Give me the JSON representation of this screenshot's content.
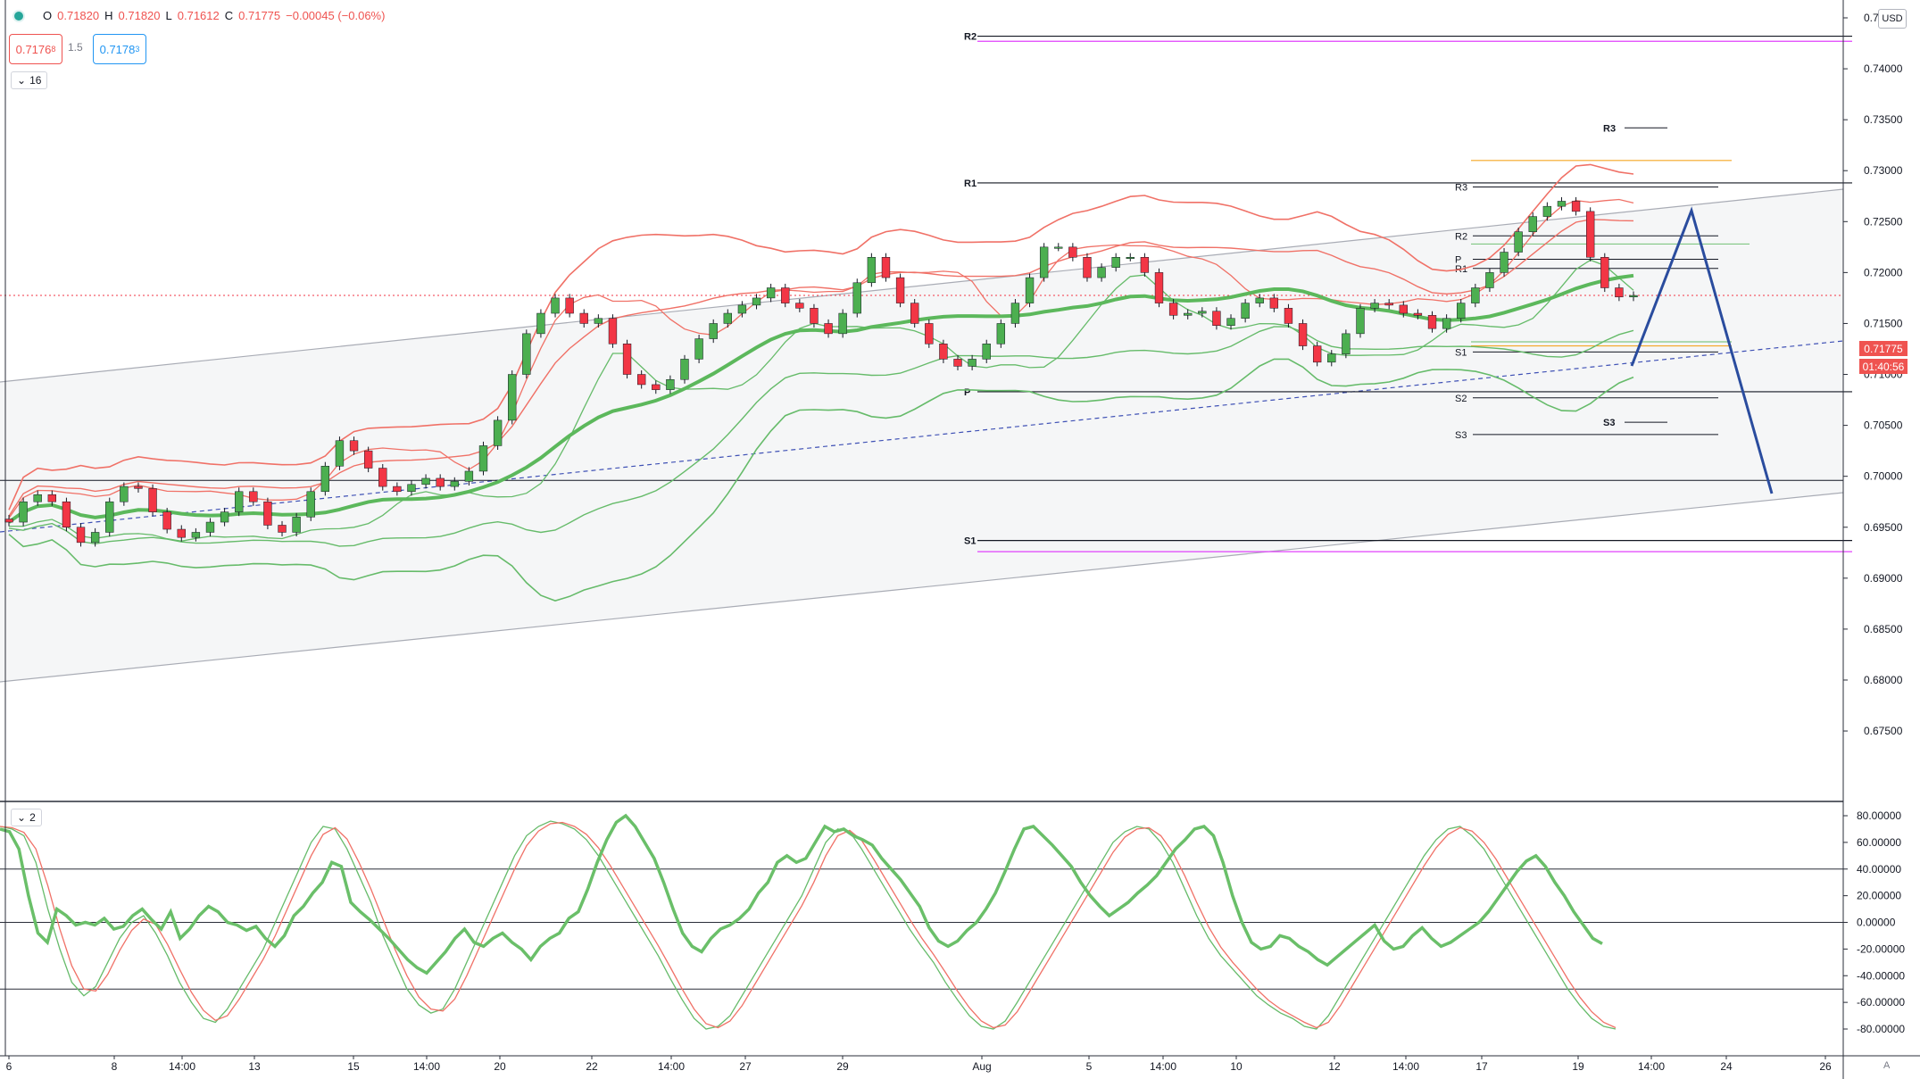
{
  "header": {
    "open_label": "O",
    "open": "0.71820",
    "high_label": "H",
    "high": "0.71820",
    "low_label": "L",
    "low": "0.71612",
    "close_label": "C",
    "close": "0.71775",
    "change": "−0.00045 (−0.06%)"
  },
  "trade": {
    "sell": "0.7176",
    "sell_sup": "8",
    "spread": "1.5",
    "buy": "0.7178",
    "buy_sup": "3"
  },
  "panes": {
    "main_count": "16",
    "osc_count": "2"
  },
  "currency": "USD",
  "last_price": "0.71775",
  "countdown": "01:40:56",
  "auto_label": "A",
  "colors": {
    "up": "#4caf50",
    "down": "#f23645",
    "bb_red": "#f07167",
    "bb_green": "#66bb6a",
    "trend": "#2a4c9e",
    "channel": "#a9acb5",
    "orange": "#f5a623",
    "magenta": "#e040fb"
  },
  "chart_data": [
    {
      "type": "candlestick",
      "title": "",
      "yaxis": {
        "ticks": [
          "0.74500",
          "0.74000",
          "0.73500",
          "0.73000",
          "0.72500",
          "0.72000",
          "0.71500",
          "0.71000",
          "0.70500",
          "0.70000",
          "0.69500",
          "0.69000",
          "0.68500",
          "0.68000",
          "0.67500"
        ],
        "range": [
          0.6715,
          0.7525
        ]
      },
      "xaxis": {
        "labels": [
          "6",
          "8",
          "14:00",
          "13",
          "15",
          "14:00",
          "20",
          "22",
          "14:00",
          "27",
          "29",
          "Aug",
          "5",
          "14:00",
          "10",
          "12",
          "14:00",
          "17",
          "19",
          "14:00",
          "24",
          "26"
        ]
      },
      "pivots_weekly": [
        {
          "label": "R2",
          "value": 0.7432
        },
        {
          "label": "R1",
          "value": 0.7288
        },
        {
          "label": "P",
          "value": 0.7083
        },
        {
          "label": "S1",
          "value": 0.6937
        }
      ],
      "pivots_daily": [
        {
          "label": "R3",
          "value": 0.7284
        },
        {
          "label": "R2",
          "value": 0.7236
        },
        {
          "label": "R1",
          "value": 0.7204
        },
        {
          "label": "P",
          "value": 0.7213
        },
        {
          "label": "S1",
          "value": 0.7122
        },
        {
          "label": "S2",
          "value": 0.7077
        },
        {
          "label": "S3",
          "value": 0.7041
        }
      ],
      "pivots_intraday": [
        {
          "label": "R3",
          "value": 0.7342
        },
        {
          "label": "S3",
          "value": 0.7053
        }
      ],
      "horizontal_line": 0.6996,
      "last_price": 0.71775,
      "close_series": [
        0.6955,
        0.6975,
        0.6982,
        0.6975,
        0.695,
        0.6935,
        0.6945,
        0.6975,
        0.699,
        0.6988,
        0.6965,
        0.6948,
        0.694,
        0.6945,
        0.6955,
        0.6965,
        0.6985,
        0.6975,
        0.6952,
        0.6945,
        0.696,
        0.6985,
        0.701,
        0.7035,
        0.7025,
        0.7008,
        0.699,
        0.6985,
        0.6992,
        0.6998,
        0.699,
        0.6995,
        0.7005,
        0.703,
        0.7055,
        0.71,
        0.714,
        0.716,
        0.7175,
        0.716,
        0.715,
        0.7155,
        0.713,
        0.71,
        0.709,
        0.7085,
        0.7095,
        0.7115,
        0.7135,
        0.715,
        0.716,
        0.7168,
        0.7175,
        0.7185,
        0.717,
        0.7165,
        0.715,
        0.714,
        0.716,
        0.719,
        0.7215,
        0.7195,
        0.717,
        0.715,
        0.713,
        0.7115,
        0.7108,
        0.7115,
        0.713,
        0.715,
        0.717,
        0.7195,
        0.7225,
        0.7225,
        0.7215,
        0.7195,
        0.7205,
        0.7215,
        0.7215,
        0.72,
        0.717,
        0.7158,
        0.716,
        0.7162,
        0.7148,
        0.7155,
        0.717,
        0.7175,
        0.7165,
        0.715,
        0.7128,
        0.7112,
        0.712,
        0.714,
        0.7165,
        0.717,
        0.7168,
        0.716,
        0.7158,
        0.7145,
        0.7155,
        0.717,
        0.7185,
        0.72,
        0.722,
        0.724,
        0.7255,
        0.7265,
        0.727,
        0.726,
        0.7215,
        0.7185,
        0.7176,
        0.71775
      ]
    },
    {
      "type": "line",
      "title": "",
      "yaxis": {
        "ticks": [
          "80.00000",
          "60.00000",
          "40.00000",
          "20.00000",
          "0.00000",
          "-20.00000",
          "-40.00000",
          "-60.00000",
          "-80.00000"
        ],
        "range": [
          -86,
          86
        ]
      },
      "levels": [
        40,
        0,
        -50
      ],
      "series": [
        {
          "values": [
            70,
            68,
            55,
            20,
            -8,
            -15,
            10,
            5,
            -2,
            0,
            -2,
            3,
            -5,
            -3,
            5,
            10,
            2,
            -5,
            8,
            -12,
            -5,
            5,
            12,
            8,
            0,
            -2,
            -6,
            -3,
            -12,
            -18,
            -10,
            5,
            12,
            22,
            30,
            45,
            42,
            15,
            8,
            2,
            -5,
            -12,
            -20,
            -28,
            -34,
            -38,
            -30,
            -22,
            -12,
            -5,
            -15,
            -18,
            -12,
            -8,
            -15,
            -20,
            -28,
            -18,
            -12,
            -8,
            3,
            8,
            25,
            45,
            62,
            75,
            80,
            72,
            60,
            48,
            30,
            10,
            -8,
            -18,
            -22,
            -12,
            -5,
            -2,
            3,
            10,
            22,
            30,
            45,
            50,
            45,
            48,
            60,
            72,
            68,
            70,
            65,
            62,
            58,
            48,
            40,
            32,
            22,
            12,
            -4,
            -14,
            -18,
            -14,
            -6,
            0,
            10,
            22,
            38,
            55,
            70,
            72,
            65,
            58,
            50,
            42,
            30,
            20,
            12,
            5,
            10,
            15,
            22,
            28,
            35,
            45,
            55,
            62,
            70,
            72,
            65,
            45,
            20,
            0,
            -15,
            -20,
            -18,
            -10,
            -12,
            -18,
            -22,
            -28,
            -32,
            -26,
            -20,
            -14,
            -8,
            -2,
            -14,
            -20,
            -18,
            -10,
            -4,
            -12,
            -18,
            -15,
            -10,
            -5,
            0,
            8,
            18,
            28,
            38,
            46,
            50,
            42,
            30,
            20,
            8,
            -2,
            -12,
            -16
          ]
        },
        {
          "values": [
            72,
            70,
            65,
            45,
            10,
            -20,
            -45,
            -55,
            -48,
            -30,
            -12,
            0,
            5,
            -8,
            -25,
            -45,
            -60,
            -72,
            -75,
            -65,
            -50,
            -35,
            -20,
            0,
            20,
            40,
            60,
            72,
            70,
            55,
            35,
            15,
            -10,
            -30,
            -50,
            -62,
            -68,
            -65,
            -50,
            -30,
            -10,
            10,
            30,
            50,
            65,
            72,
            76,
            74,
            70,
            62,
            50,
            35,
            20,
            5,
            -10,
            -25,
            -42,
            -58,
            -72,
            -80,
            -78,
            -70,
            -55,
            -40,
            -25,
            -10,
            5,
            20,
            40,
            60,
            70,
            68,
            55,
            40,
            25,
            10,
            -5,
            -18,
            -30,
            -45,
            -58,
            -70,
            -78,
            -80,
            -74,
            -60,
            -45,
            -30,
            -15,
            0,
            15,
            30,
            45,
            60,
            68,
            72,
            70,
            60,
            45,
            25,
            5,
            -12,
            -25,
            -35,
            -45,
            -55,
            -62,
            -68,
            -72,
            -78,
            -80,
            -70,
            -55,
            -40,
            -25,
            -10,
            5,
            20,
            35,
            50,
            62,
            70,
            72,
            65,
            55,
            40,
            25,
            10,
            -5,
            -20,
            -35,
            -50,
            -62,
            -72,
            -78,
            -80
          ]
        }
      ]
    }
  ]
}
